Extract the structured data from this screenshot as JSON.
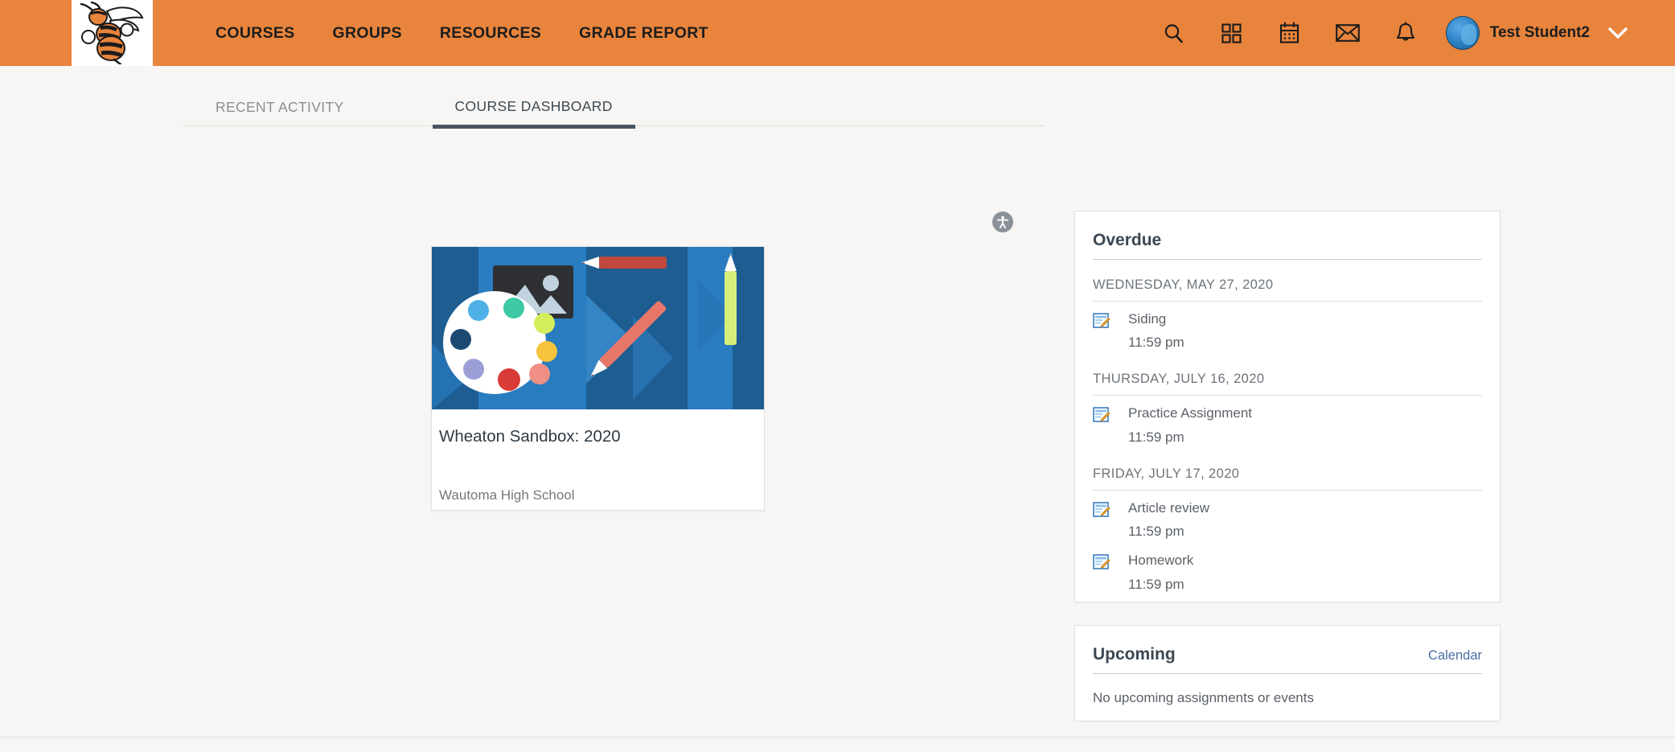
{
  "brand": {
    "header_bg": "#e8843c",
    "accent": "#4a6fa5",
    "logo_name": "hornet-mascot-logo",
    "logo_alt": "Hornet mascot"
  },
  "topnav": {
    "links": [
      {
        "label": "COURSES",
        "name": "nav-link-courses"
      },
      {
        "label": "GROUPS",
        "name": "nav-link-groups"
      },
      {
        "label": "RESOURCES",
        "name": "nav-link-resources"
      },
      {
        "label": "GRADE REPORT",
        "name": "nav-link-grade-report"
      }
    ],
    "icons": [
      {
        "name": "search-icon",
        "label": "Search"
      },
      {
        "name": "apps-grid-icon",
        "label": "Apps"
      },
      {
        "name": "calendar-icon",
        "label": "Calendar"
      },
      {
        "name": "envelope-mail-icon",
        "label": "Messages"
      },
      {
        "name": "bell-notification-icon",
        "label": "Notifications"
      }
    ],
    "user": {
      "name": "Test Student2",
      "avatar_name": "user-avatar",
      "chevron_name": "chevron-down-icon"
    }
  },
  "tabs": [
    {
      "label": "RECENT ACTIVITY",
      "active": false
    },
    {
      "label": "COURSE DASHBOARD",
      "active": true
    }
  ],
  "accessibility_button": {
    "name": "accessibility-icon",
    "label": "Accessibility"
  },
  "course_card": {
    "title": "Wheaton Sandbox: 2020",
    "subtitle": "Wautoma High School",
    "art": {
      "name": "course-card-artwork",
      "bg": "#1d5d92",
      "palette_colors": [
        "#4fb0e8",
        "#3dc9a4",
        "#d4ef5c",
        "#1d4a73",
        "#f5c33c",
        "#9b9fd6",
        "#d93b36",
        "#ef8f86"
      ],
      "pencils": [
        "#c0483c",
        "#e8776a",
        "#d6ef7a"
      ]
    }
  },
  "overdue": {
    "title": "Overdue",
    "groups": [
      {
        "date": "WEDNESDAY, MAY 27, 2020",
        "items": [
          {
            "name": "Siding",
            "time": "11:59 pm",
            "icon": "assignment-icon"
          }
        ]
      },
      {
        "date": "THURSDAY, JULY 16, 2020",
        "items": [
          {
            "name": "Practice Assignment",
            "time": "11:59 pm",
            "icon": "assignment-icon"
          }
        ]
      },
      {
        "date": "FRIDAY, JULY 17, 2020",
        "items": [
          {
            "name": "Article review",
            "time": "11:59 pm",
            "icon": "assignment-icon"
          },
          {
            "name": "Homework",
            "time": "11:59 pm",
            "icon": "assignment-icon"
          }
        ]
      }
    ]
  },
  "upcoming": {
    "title": "Upcoming",
    "link_label": "Calendar",
    "empty_message": "No upcoming assignments or events"
  }
}
